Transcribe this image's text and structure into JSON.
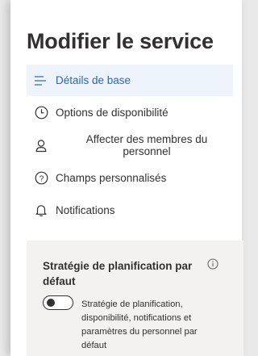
{
  "panel": {
    "title": "Modifier le service",
    "nav": [
      {
        "label": "Détails de base",
        "icon": "list-lines-icon",
        "selected": true
      },
      {
        "label": "Options de disponibilité",
        "icon": "clock-icon",
        "selected": false
      },
      {
        "label": "Affecter des membres du personnel",
        "icon": "person-icon",
        "selected": false
      },
      {
        "label": "Champs personnalisés",
        "icon": "question-circle-icon",
        "selected": false
      },
      {
        "label": "Notifications",
        "icon": "bell-icon",
        "selected": false
      }
    ],
    "section": {
      "title": "Stratégie de planification par défaut",
      "info_icon": "info-icon",
      "toggle_on": false,
      "toggle_description": "Stratégie de planification, disponibilité, notifications et paramètres du personnel par défaut"
    }
  },
  "colors": {
    "accent": "#2b64c6",
    "selected_bg": "#eef4fb",
    "section_bg": "#f3f2f1",
    "backdrop": "#e9e9e9"
  }
}
